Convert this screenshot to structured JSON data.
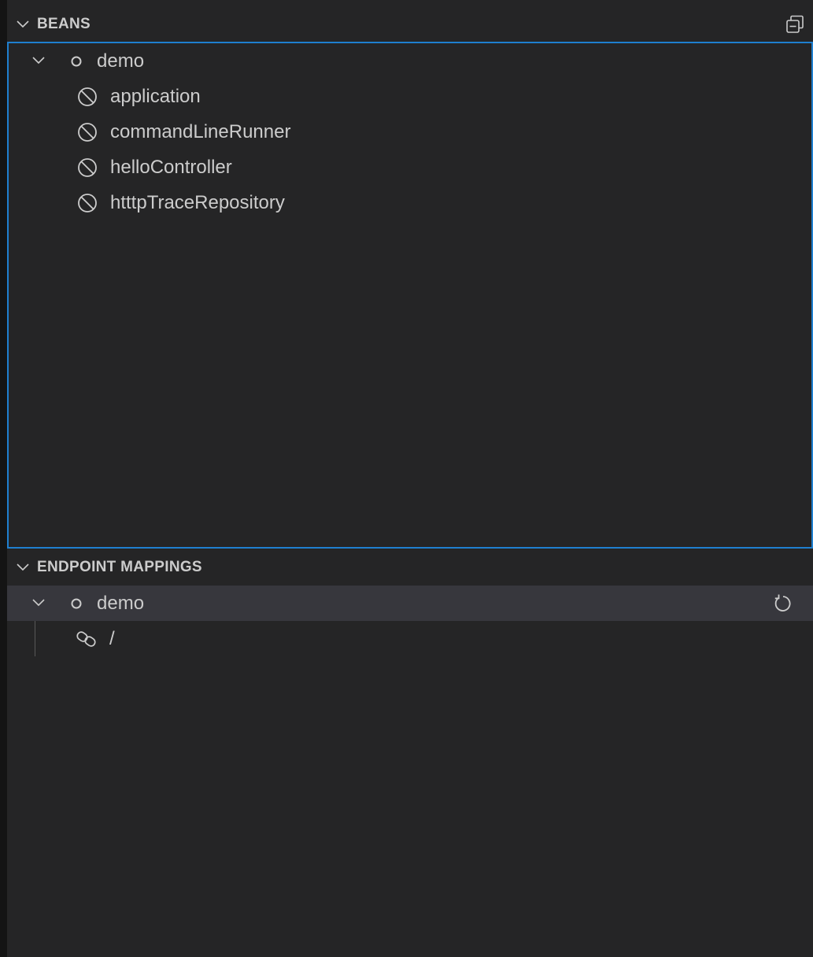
{
  "beans_view": {
    "title": "BEANS",
    "header_action_icon": "collapse-all-icon",
    "root": {
      "label": "demo",
      "expanded": true,
      "icon": "circle-outline-icon"
    },
    "items": [
      {
        "label": "application",
        "icon": "bean-icon"
      },
      {
        "label": "commandLineRunner",
        "icon": "bean-icon"
      },
      {
        "label": "helloController",
        "icon": "bean-icon"
      },
      {
        "label": "htttpTraceRepository",
        "icon": "bean-icon"
      }
    ]
  },
  "endpoints_view": {
    "title": "ENDPOINT MAPPINGS",
    "root": {
      "label": "demo",
      "expanded": true,
      "icon": "circle-outline-icon",
      "action_icon": "refresh-icon"
    },
    "items": [
      {
        "label": "/",
        "icon": "link-icon"
      }
    ]
  },
  "colors": {
    "background": "#252526",
    "text": "#cccccc",
    "focus_border": "#1f7fcf",
    "selected_row": "#37373d"
  }
}
